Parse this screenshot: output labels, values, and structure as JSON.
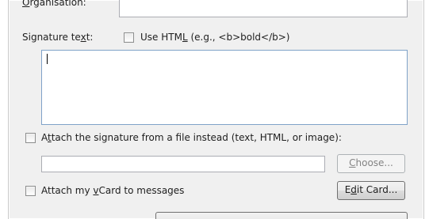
{
  "organisation": {
    "label_prefix": "",
    "label_accel": "O",
    "label_rest": "rganisation:"
  },
  "signature": {
    "label_pre": "Signature te",
    "label_accel": "x",
    "label_post": "t:",
    "use_html_pre": "Use HTM",
    "use_html_accel": "L",
    "use_html_post": " (e.g., <b>bold</b>)",
    "text_value": ""
  },
  "attach_file": {
    "label_pre": "A",
    "label_accel": "t",
    "label_post": "tach the signature from a file instead (text, HTML, or image):",
    "path_value": "",
    "choose_pre": "",
    "choose_accel": "C",
    "choose_post": "hoose..."
  },
  "vcard": {
    "label_pre": "Attach my ",
    "label_accel": "v",
    "label_post": "Card to messages",
    "edit_pre": "E",
    "edit_accel": "d",
    "edit_post": "it Card..."
  }
}
